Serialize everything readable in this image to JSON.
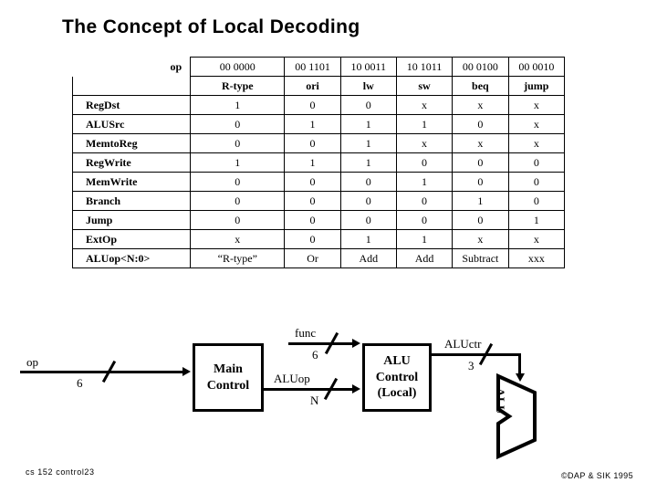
{
  "slide": {
    "title": "The Concept of Local Decoding",
    "footer_left": "cs 152  control23",
    "footer_right": "©DAP & SIK 1995"
  },
  "table": {
    "op_label": "op",
    "opcodes": [
      "00 0000",
      "00 1101",
      "10 0011",
      "10 1011",
      "00 0100",
      "00 0010"
    ],
    "instructions": [
      "R-type",
      "ori",
      "lw",
      "sw",
      "beq",
      "jump"
    ],
    "rows": [
      {
        "signal": "RegDst",
        "values": [
          "1",
          "0",
          "0",
          "x",
          "x",
          "x"
        ]
      },
      {
        "signal": "ALUSrc",
        "values": [
          "0",
          "1",
          "1",
          "1",
          "0",
          "x"
        ]
      },
      {
        "signal": "MemtoReg",
        "values": [
          "0",
          "0",
          "1",
          "x",
          "x",
          "x"
        ]
      },
      {
        "signal": "RegWrite",
        "values": [
          "1",
          "1",
          "1",
          "0",
          "0",
          "0"
        ]
      },
      {
        "signal": "MemWrite",
        "values": [
          "0",
          "0",
          "0",
          "1",
          "0",
          "0"
        ]
      },
      {
        "signal": "Branch",
        "values": [
          "0",
          "0",
          "0",
          "0",
          "1",
          "0"
        ]
      },
      {
        "signal": "Jump",
        "values": [
          "0",
          "0",
          "0",
          "0",
          "0",
          "1"
        ]
      },
      {
        "signal": "ExtOp",
        "values": [
          "x",
          "0",
          "1",
          "1",
          "x",
          "x"
        ]
      },
      {
        "signal": "ALUop<N:0>",
        "values": [
          "“R-type”",
          "Or",
          "Add",
          "Add",
          "Subtract",
          "xxx"
        ]
      }
    ]
  },
  "diagram": {
    "main_control": {
      "line1": "Main",
      "line2": "Control"
    },
    "alu_control": {
      "line1": "ALU",
      "line2": "Control",
      "line3": "(Local)"
    },
    "alu_unit_label": "ALU",
    "wires": {
      "op_label": "op",
      "op_width": "6",
      "func_label": "func",
      "func_width": "6",
      "aluop_label": "ALUop",
      "aluop_width": "N",
      "aluctr_label": "ALUctr",
      "aluctr_width": "3"
    }
  }
}
